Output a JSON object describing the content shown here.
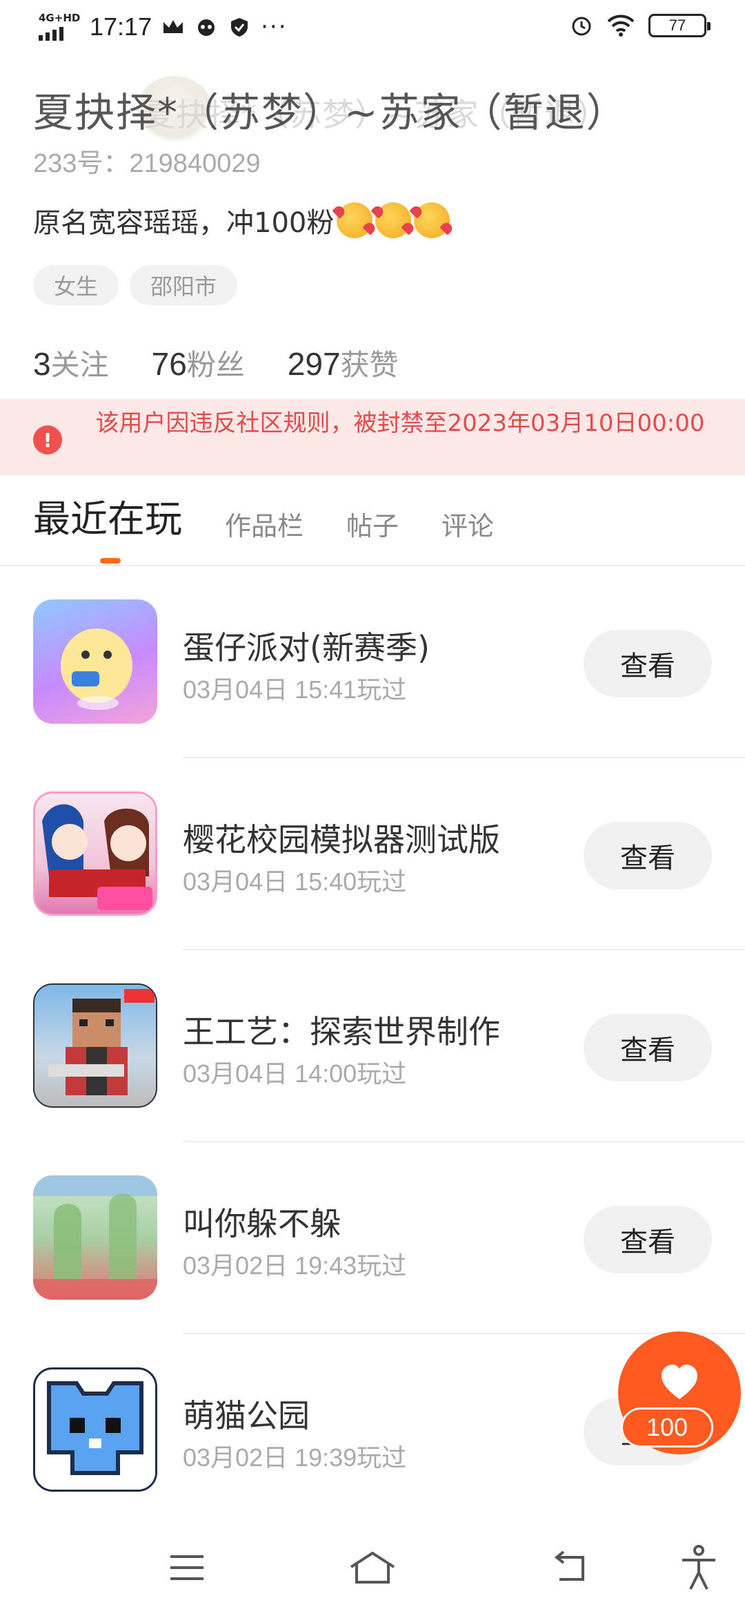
{
  "status_bar": {
    "network": "4G+HD",
    "time": "17:17",
    "more": "···",
    "battery": "77"
  },
  "profile": {
    "name": "夏抉择*（苏梦）~苏家（暂退）",
    "name_shadow": "夏抉择*（苏梦）~苏家（暂退）",
    "uid": "233号：219840029",
    "bio": "原名宽容瑶瑶，冲100粉",
    "tags": [
      "女生",
      "邵阳市"
    ],
    "stats": [
      {
        "num": "3",
        "label": "关注"
      },
      {
        "num": "76",
        "label": "粉丝"
      },
      {
        "num": "297",
        "label": "获赞"
      }
    ]
  },
  "ban_notice": {
    "icon": "!",
    "text": "该用户因违反社区规则，被封禁至2023年03月10日00:00"
  },
  "tabs": [
    "最近在玩",
    "作品栏",
    "帖子",
    "评论"
  ],
  "games": [
    {
      "title": "蛋仔派对(新赛季)",
      "time": "03月04日 15:41玩过",
      "button": "查看"
    },
    {
      "title": "樱花校园模拟器测试版",
      "time": "03月04日 15:40玩过",
      "button": "查看"
    },
    {
      "title": "王工艺：探索世界制作",
      "time": "03月04日 14:00玩过",
      "button": "查看"
    },
    {
      "title": "叫你躲不躲",
      "time": "03月02日 19:43玩过",
      "button": "查看"
    },
    {
      "title": "萌猫公园",
      "time": "03月02日 19:39玩过",
      "button": "查看"
    }
  ],
  "like_fab": {
    "count": "100",
    "color": "#ff5a1f"
  },
  "colors": {
    "accent": "#ff6b1a",
    "ban_text": "#e24b4b",
    "ban_bg": "#fde8e8"
  }
}
